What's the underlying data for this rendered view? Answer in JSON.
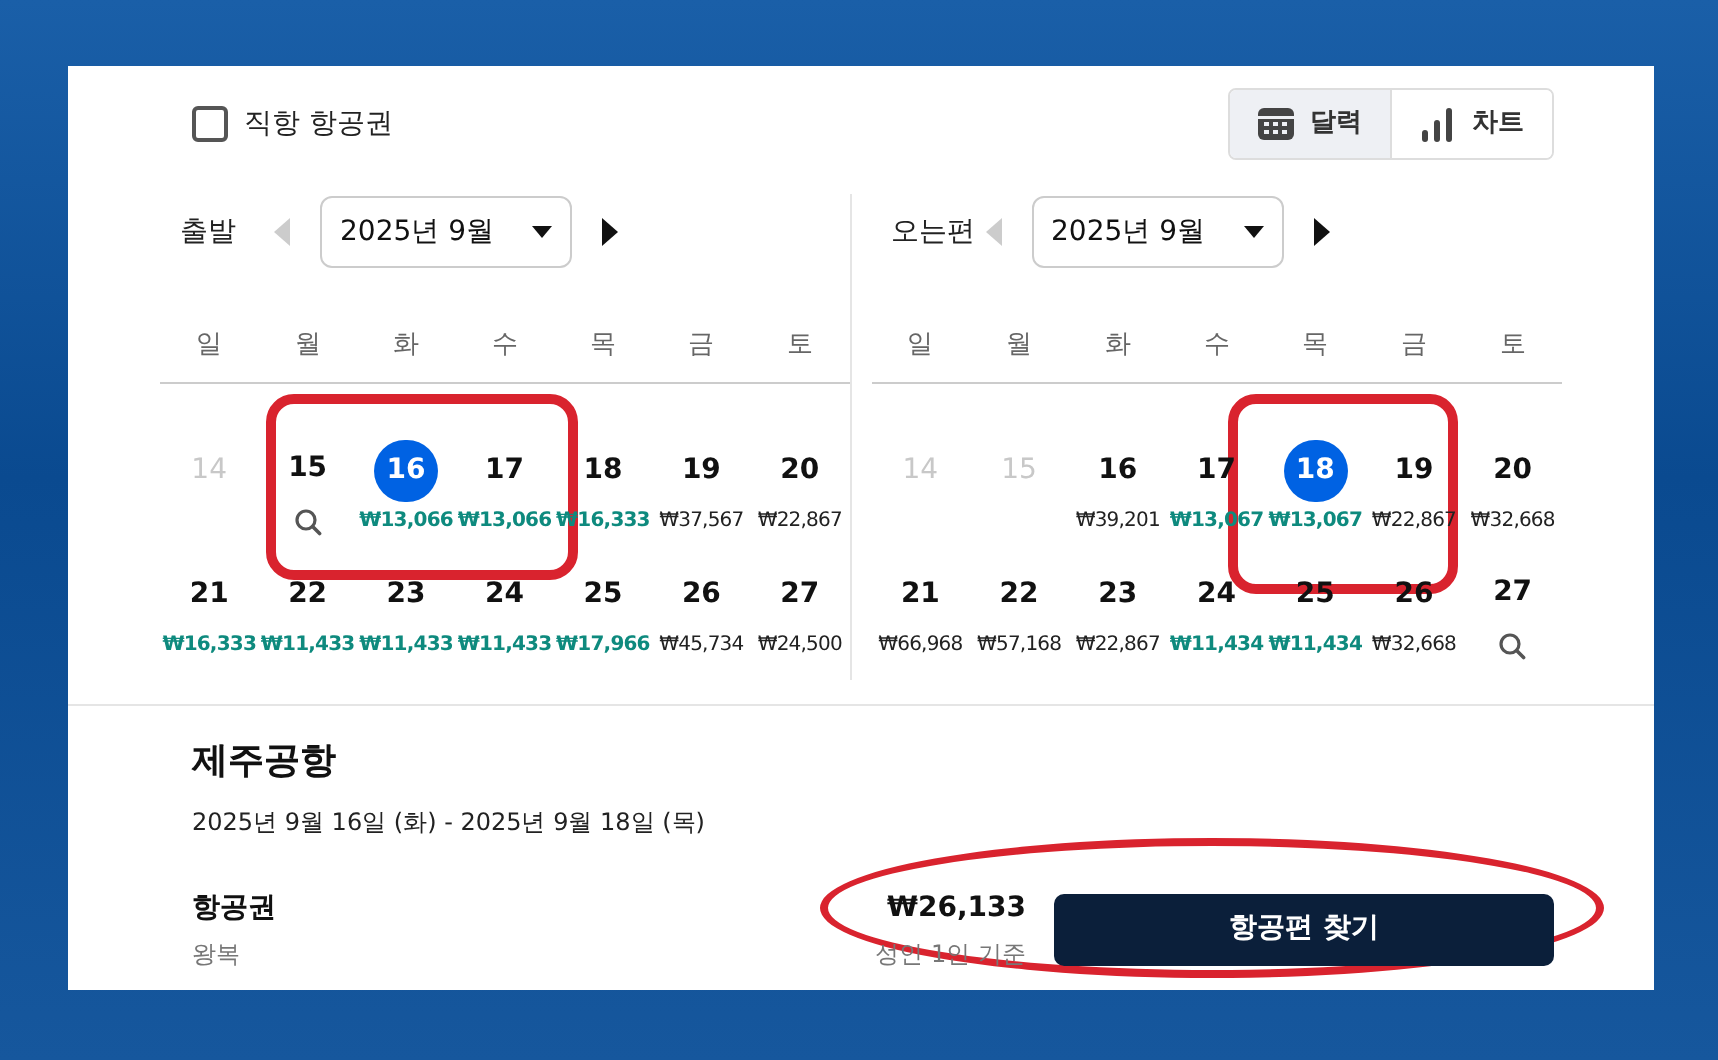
{
  "direct_only": {
    "label": "직항 항공권",
    "checked": false
  },
  "view_toggle": [
    {
      "label": "달력",
      "kind": "calendar",
      "selected": true
    },
    {
      "label": "차트",
      "kind": "chart",
      "selected": false
    }
  ],
  "calendars": [
    {
      "label": "출발",
      "month": "2025년 9월",
      "prev_disabled": true,
      "weekdays": [
        "일",
        "월",
        "화",
        "수",
        "목",
        "금",
        "토"
      ],
      "days": [
        {
          "day": "14",
          "kind": "disabled",
          "selected": false
        },
        {
          "day": "15",
          "kind": "search",
          "selected": false
        },
        {
          "day": "16",
          "kind": "price",
          "price": "₩13,066",
          "cheap": true,
          "selected": true
        },
        {
          "day": "17",
          "kind": "price",
          "price": "₩13,066",
          "cheap": true,
          "selected": false
        },
        {
          "day": "18",
          "kind": "price",
          "price": "₩16,333",
          "cheap": true,
          "selected": false
        },
        {
          "day": "19",
          "kind": "price",
          "price": "₩37,567",
          "cheap": false,
          "selected": false
        },
        {
          "day": "20",
          "kind": "price",
          "price": "₩22,867",
          "cheap": false,
          "selected": false
        },
        {
          "day": "21",
          "kind": "price",
          "price": "₩16,333",
          "cheap": true,
          "selected": false
        },
        {
          "day": "22",
          "kind": "price",
          "price": "₩11,433",
          "cheap": true,
          "selected": false
        },
        {
          "day": "23",
          "kind": "price",
          "price": "₩11,433",
          "cheap": true,
          "selected": false
        },
        {
          "day": "24",
          "kind": "price",
          "price": "₩11,433",
          "cheap": true,
          "selected": false
        },
        {
          "day": "25",
          "kind": "price",
          "price": "₩17,966",
          "cheap": true,
          "selected": false
        },
        {
          "day": "26",
          "kind": "price",
          "price": "₩45,734",
          "cheap": false,
          "selected": false
        },
        {
          "day": "27",
          "kind": "price",
          "price": "₩24,500",
          "cheap": false,
          "selected": false
        }
      ]
    },
    {
      "label": "오는편",
      "month": "2025년 9월",
      "prev_disabled": true,
      "weekdays": [
        "일",
        "월",
        "화",
        "수",
        "목",
        "금",
        "토"
      ],
      "days": [
        {
          "day": "14",
          "kind": "disabled",
          "selected": false
        },
        {
          "day": "15",
          "kind": "disabled",
          "selected": false
        },
        {
          "day": "16",
          "kind": "price",
          "price": "₩39,201",
          "cheap": false,
          "selected": false
        },
        {
          "day": "17",
          "kind": "price",
          "price": "₩13,067",
          "cheap": true,
          "selected": false
        },
        {
          "day": "18",
          "kind": "price",
          "price": "₩13,067",
          "cheap": true,
          "selected": true
        },
        {
          "day": "19",
          "kind": "price",
          "price": "₩22,867",
          "cheap": false,
          "selected": false
        },
        {
          "day": "20",
          "kind": "price",
          "price": "₩32,668",
          "cheap": false,
          "selected": false
        },
        {
          "day": "21",
          "kind": "price",
          "price": "₩66,968",
          "cheap": false,
          "selected": false
        },
        {
          "day": "22",
          "kind": "price",
          "price": "₩57,168",
          "cheap": false,
          "selected": false
        },
        {
          "day": "23",
          "kind": "price",
          "price": "₩22,867",
          "cheap": false,
          "selected": false
        },
        {
          "day": "24",
          "kind": "price",
          "price": "₩11,434",
          "cheap": true,
          "selected": false
        },
        {
          "day": "25",
          "kind": "price",
          "price": "₩11,434",
          "cheap": true,
          "selected": false
        },
        {
          "day": "26",
          "kind": "price",
          "price": "₩32,668",
          "cheap": false,
          "selected": false
        },
        {
          "day": "27",
          "kind": "search",
          "selected": false
        }
      ]
    }
  ],
  "summary": {
    "destination": "제주공항",
    "dates": "2025년 9월 16일 (화) - 2025년 9월 18일 (목)",
    "product": "항공권",
    "trip": "왕복",
    "price": "₩26,133",
    "price_note": "성인 1인 기준",
    "button": "항공편 찾기"
  }
}
